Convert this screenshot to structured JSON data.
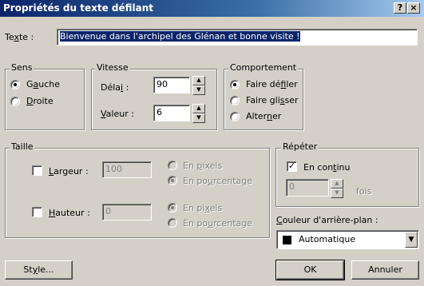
{
  "window": {
    "title": "Propriétés du texte défilant",
    "help_label": "?",
    "close_label": "×"
  },
  "text_field": {
    "label_pre": "Te",
    "label_key": "x",
    "label_post": "te :",
    "value": "Bienvenue dans l'archipel des Glénan et bonne visite !"
  },
  "direction": {
    "legend": "Sens",
    "left": {
      "pre": "G",
      "key": "a",
      "post": "uche",
      "checked": true
    },
    "right": {
      "pre": "",
      "key": "D",
      "post": "roite",
      "checked": false
    }
  },
  "speed": {
    "legend": "Vitesse",
    "delay": {
      "pre": "Déla",
      "key": "i",
      "post": " :",
      "value": "90"
    },
    "amount": {
      "pre": "",
      "key": "V",
      "post": "aleur :",
      "value": "6"
    }
  },
  "behavior": {
    "legend": "Comportement",
    "scroll": {
      "pre": "Faire dé",
      "key": "f",
      "post": "iler",
      "checked": true
    },
    "slide": {
      "pre": "Faire gli",
      "key": "s",
      "post": "ser",
      "checked": false
    },
    "alternate": {
      "pre": "Alter",
      "key": "n",
      "post": "er",
      "checked": false
    }
  },
  "size": {
    "legend": "Taille",
    "width": {
      "pre": "",
      "key": "L",
      "post": "argeur :",
      "value": "100",
      "checked": false,
      "pixels": {
        "pre": "En ",
        "key": "p",
        "post": "ixels",
        "checked": false
      },
      "percent": {
        "pre": "En po",
        "key": "u",
        "post": "rcentage",
        "checked": true
      }
    },
    "height": {
      "pre": "",
      "key": "H",
      "post": "auteur :",
      "value": "0",
      "checked": false,
      "pixels": {
        "pre": "En pi",
        "key": "x",
        "post": "els",
        "checked": true
      },
      "percent": {
        "pre": "En po",
        "key": "u",
        "post": "rcentage",
        "checked": false
      }
    }
  },
  "repeat": {
    "legend": "Répéter",
    "continuous": {
      "pre": "En con",
      "key": "t",
      "post": "inu",
      "checked": true
    },
    "count_value": "0",
    "count_unit": "fois"
  },
  "background": {
    "label_pre": "",
    "label_key": "C",
    "label_post": "ouleur d'arrière-plan :",
    "selected": "Automatique",
    "swatch_color": "#000000"
  },
  "buttons": {
    "style": {
      "pre": "St",
      "key": "y",
      "post": "le..."
    },
    "ok": "OK",
    "cancel": "Annuler"
  }
}
